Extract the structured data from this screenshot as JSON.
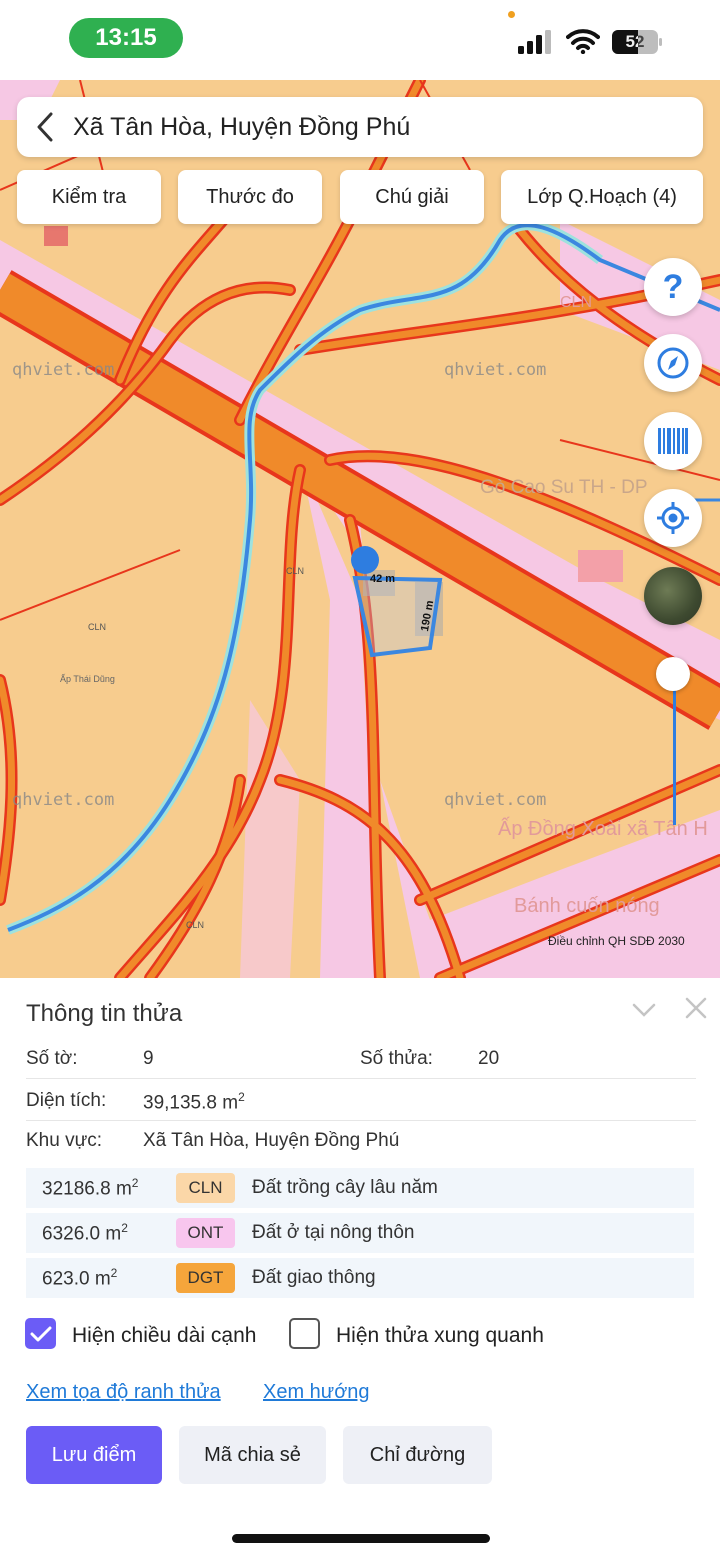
{
  "status_bar": {
    "time": "13:15",
    "battery": "52",
    "icons": [
      "signal-icon",
      "wifi-icon",
      "battery-icon"
    ]
  },
  "search": {
    "back_icon": "chevron-left-icon",
    "title": "Xã Tân Hòa, Huyện Đồng Phú"
  },
  "toolbar": {
    "check_label": "Kiểm tra",
    "ruler_label": "Thước đo",
    "legend_label": "Chú giải",
    "layers_label": "Lớp Q.Hoạch (4)"
  },
  "map_controls": [
    "help-icon",
    "compass-icon",
    "barcode-icon",
    "locate-icon",
    "satellite-thumbnail",
    "opacity-slider"
  ],
  "map": {
    "watermark_1": "qhviet.com",
    "watermark_2": "qhviet.com",
    "watermark_3": "qhviet.com",
    "watermark_4": "qhviet.com",
    "place_label_1": "Gò Cao Su TH - DP",
    "place_label_2": "Ấp Đồng Xoài xã Tân H",
    "place_label_3": "Bánh cuốn nóng",
    "edge_1": "42 m",
    "edge_2": "190 m",
    "zone_code_1": "CLN",
    "zone_code_2": "CLN",
    "zone_code_3": "CLN",
    "zone_code_4": "CLN",
    "small_label_1": "Ấp Thái Dũng",
    "adjust_caption": "Điều chỉnh QH SDĐ 2030",
    "colors": {
      "land": "#f7cc8e",
      "road": "#f08a2a",
      "road_edge": "#e8361c",
      "residential": "#f6c8e4",
      "boundary": "#3b87e0",
      "water": "#9ee2de"
    }
  },
  "parcel": {
    "panel_title": "Thông tin thửa",
    "sheet_label": "Số tờ:",
    "sheet_value": "9",
    "plot_label": "Số thửa:",
    "plot_value": "20",
    "area_label": "Diện tích:",
    "area_value": "39,135.8 m",
    "area_unit_sup": "2",
    "region_label": "Khu vực:",
    "region_value": "Xã Tân Hòa, Huyện Đồng Phú",
    "land_use": [
      {
        "area": "32186.8 m",
        "sup": "2",
        "code": "CLN",
        "name": "Đất trồng cây lâu năm",
        "color": "#fbd7a8"
      },
      {
        "area": "6326.0 m",
        "sup": "2",
        "code": "ONT",
        "name": "Đất ở tại nông thôn",
        "color": "#f8c6ee"
      },
      {
        "area": "623.0 m",
        "sup": "2",
        "code": "DGT",
        "name": "Đất giao thông",
        "color": "#f5a53b"
      }
    ],
    "show_edge_length": {
      "label": "Hiện chiều dài cạnh",
      "checked": true
    },
    "show_neighbors": {
      "label": "Hiện thửa xung quanh",
      "checked": false
    },
    "link_coords": "Xem tọa độ ranh thửa",
    "link_direction": "Xem hướng",
    "save_label": "Lưu điểm",
    "share_label": "Mã chia sẻ",
    "directions_label": "Chỉ đường"
  }
}
